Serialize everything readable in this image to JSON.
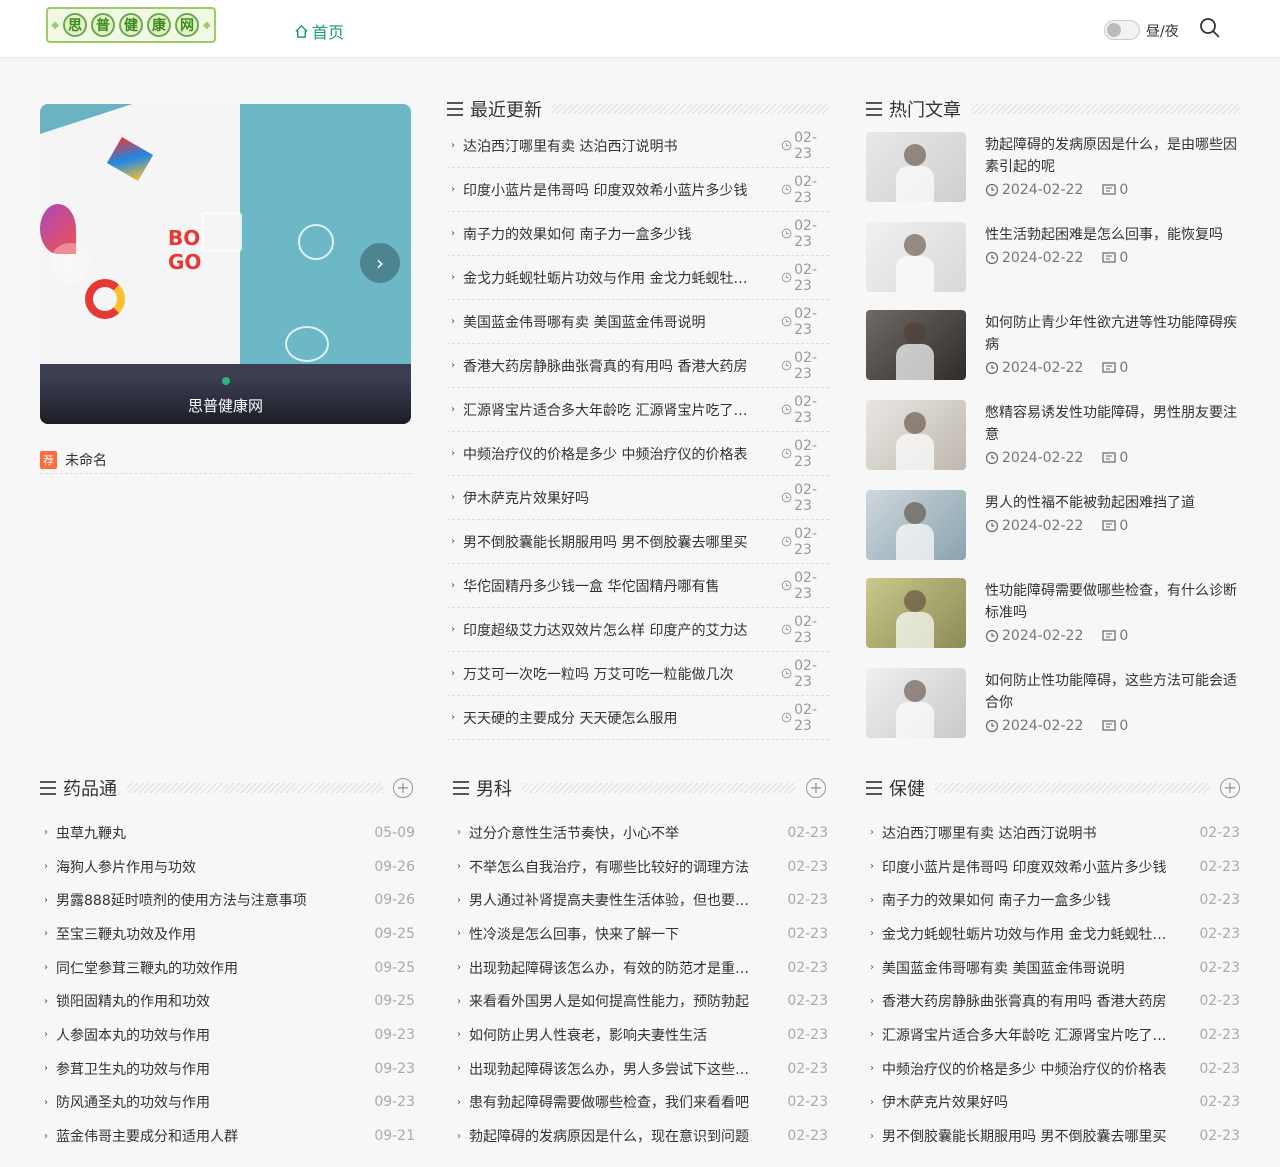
{
  "header": {
    "logo_chars": [
      "思",
      "普",
      "健",
      "康",
      "网"
    ],
    "nav_home": "首页",
    "daynight": "昼/夜"
  },
  "slider": {
    "caption": "思普健康网",
    "prev": "‹",
    "next": "›"
  },
  "recommend": {
    "tag": "荐",
    "text": "未命名"
  },
  "latest": {
    "title": "最近更新",
    "items": [
      {
        "title": "达泊西汀哪里有卖 达泊西汀说明书",
        "date": "02-23"
      },
      {
        "title": "印度小蓝片是伟哥吗 印度双效希小蓝片多少钱",
        "date": "02-23"
      },
      {
        "title": "南子力的效果如何 南子力一盒多少钱",
        "date": "02-23"
      },
      {
        "title": "金戈力蚝蚬牡蛎片功效与作用 金戈力蚝蚬牡蛎片",
        "date": "02-23"
      },
      {
        "title": "美国蓝金伟哥哪有卖 美国蓝金伟哥说明",
        "date": "02-23"
      },
      {
        "title": "香港大药房静脉曲张膏真的有用吗 香港大药房",
        "date": "02-23"
      },
      {
        "title": "汇源肾宝片适合多大年龄吃 汇源肾宝片吃了多久",
        "date": "02-23"
      },
      {
        "title": "中频治疗仪的价格是多少 中频治疗仪的价格表",
        "date": "02-23"
      },
      {
        "title": "伊木萨克片效果好吗",
        "date": "02-23"
      },
      {
        "title": "男不倒胶囊能长期服用吗 男不倒胶囊去哪里买",
        "date": "02-23"
      },
      {
        "title": "华佗固精丹多少钱一盒 华佗固精丹哪有售",
        "date": "02-23"
      },
      {
        "title": "印度超级艾力达双效片怎么样 印度产的艾力达",
        "date": "02-23"
      },
      {
        "title": "万艾可一次吃一粒吗 万艾可吃一粒能做几次",
        "date": "02-23"
      },
      {
        "title": "天天硬的主要成分 天天硬怎么服用",
        "date": "02-23"
      }
    ]
  },
  "hot": {
    "title": "热门文章",
    "items": [
      {
        "title": "勃起障碍的发病原因是什么，是由哪些因素引起的呢",
        "date": "2024-02-22",
        "comments": "0"
      },
      {
        "title": "性生活勃起困难是怎么回事，能恢复吗",
        "date": "2024-02-22",
        "comments": "0"
      },
      {
        "title": "如何防止青少年性欲亢进等性功能障碍疾病",
        "date": "2024-02-22",
        "comments": "0"
      },
      {
        "title": "憋精容易诱发性功能障碍，男性朋友要注意",
        "date": "2024-02-22",
        "comments": "0"
      },
      {
        "title": "男人的性福不能被勃起困难挡了道",
        "date": "2024-02-22",
        "comments": "0"
      },
      {
        "title": "性功能障碍需要做哪些检查，有什么诊断标准吗",
        "date": "2024-02-22",
        "comments": "0"
      },
      {
        "title": "如何防止性功能障碍，这些方法可能会适合你",
        "date": "2024-02-22",
        "comments": "0"
      }
    ]
  },
  "sections": [
    {
      "title": "药品通",
      "more": "+",
      "items": [
        {
          "title": "虫草九鞭丸",
          "date": "05-09"
        },
        {
          "title": "海狗人参片作用与功效",
          "date": "09-26"
        },
        {
          "title": "男露888延时喷剂的使用方法与注意事项",
          "date": "09-26"
        },
        {
          "title": "至宝三鞭丸功效及作用",
          "date": "09-25"
        },
        {
          "title": "同仁堂参茸三鞭丸的功效作用",
          "date": "09-25"
        },
        {
          "title": "锁阳固精丸的作用和功效",
          "date": "09-25"
        },
        {
          "title": "人参固本丸的功效与作用",
          "date": "09-23"
        },
        {
          "title": "参茸卫生丸的功效与作用",
          "date": "09-23"
        },
        {
          "title": "防风通圣丸的功效与作用",
          "date": "09-23"
        },
        {
          "title": "蓝金伟哥主要成分和适用人群",
          "date": "09-21"
        }
      ]
    },
    {
      "title": "男科",
      "more": "+",
      "items": [
        {
          "title": "过分介意性生活节奏快，小心不举",
          "date": "02-23"
        },
        {
          "title": "不举怎么自我治疗，有哪些比较好的调理方法",
          "date": "02-23"
        },
        {
          "title": "男人通过补肾提高夫妻性生活体验，但也要注意",
          "date": "02-23"
        },
        {
          "title": "性冷淡是怎么回事，快来了解一下",
          "date": "02-23"
        },
        {
          "title": "出现勃起障碍该怎么办，有效的防范才是重要的",
          "date": "02-23"
        },
        {
          "title": "来看看外国男人是如何提高性能力，预防勃起",
          "date": "02-23"
        },
        {
          "title": "如何防止男人性衰老，影响夫妻性生活",
          "date": "02-23"
        },
        {
          "title": "出现勃起障碍该怎么办，男人多尝试下这些方法",
          "date": "02-23"
        },
        {
          "title": "患有勃起障碍需要做哪些检查，我们来看看吧",
          "date": "02-23"
        },
        {
          "title": "勃起障碍的发病原因是什么，现在意识到问题",
          "date": "02-23"
        }
      ]
    },
    {
      "title": "保健",
      "more": "+",
      "items": [
        {
          "title": "达泊西汀哪里有卖 达泊西汀说明书",
          "date": "02-23"
        },
        {
          "title": "印度小蓝片是伟哥吗 印度双效希小蓝片多少钱",
          "date": "02-23"
        },
        {
          "title": "南子力的效果如何 南子力一盒多少钱",
          "date": "02-23"
        },
        {
          "title": "金戈力蚝蚬牡蛎片功效与作用 金戈力蚝蚬牡蛎片",
          "date": "02-23"
        },
        {
          "title": "美国蓝金伟哥哪有卖 美国蓝金伟哥说明",
          "date": "02-23"
        },
        {
          "title": "香港大药房静脉曲张膏真的有用吗 香港大药房",
          "date": "02-23"
        },
        {
          "title": "汇源肾宝片适合多大年龄吃 汇源肾宝片吃了多久",
          "date": "02-23"
        },
        {
          "title": "中频治疗仪的价格是多少 中频治疗仪的价格表",
          "date": "02-23"
        },
        {
          "title": "伊木萨克片效果好吗",
          "date": "02-23"
        },
        {
          "title": "男不倒胶囊能长期服用吗 男不倒胶囊去哪里买",
          "date": "02-23"
        }
      ]
    }
  ],
  "colors": {
    "accent": "#1a9e6a",
    "logo_green": "#6aa84f",
    "tag_orange": "#ff6b3d"
  }
}
